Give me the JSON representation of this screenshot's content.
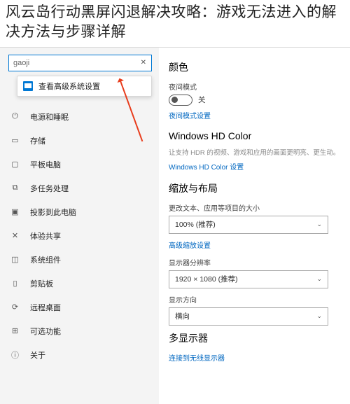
{
  "page_title": "风云岛行动黑屏闪退解决攻略：游戏无法进入的解决方法与步骤详解",
  "search": {
    "value": "gaoji",
    "dropdown_item": "查看高级系统设置"
  },
  "sidebar": {
    "items": [
      {
        "label": "电源和睡眠"
      },
      {
        "label": "存储"
      },
      {
        "label": "平板电脑"
      },
      {
        "label": "多任务处理"
      },
      {
        "label": "投影到此电脑"
      },
      {
        "label": "体验共享"
      },
      {
        "label": "系统组件"
      },
      {
        "label": "剪贴板"
      },
      {
        "label": "远程桌面"
      },
      {
        "label": "可选功能"
      },
      {
        "label": "关于"
      }
    ]
  },
  "content": {
    "color": {
      "heading": "颜色",
      "night_label": "夜间模式",
      "night_state": "关",
      "night_link": "夜间模式设置"
    },
    "hdcolor": {
      "heading": "Windows HD Color",
      "desc": "让支持 HDR 的视频、游戏和应用的画面更明亮、更生动。",
      "link": "Windows HD Color 设置"
    },
    "scale": {
      "heading": "缩放与布局",
      "size_label": "更改文本、应用等项目的大小",
      "size_value": "100% (推荐)",
      "scale_link": "高级缩放设置",
      "res_label": "显示器分辨率",
      "res_value": "1920 × 1080 (推荐)",
      "orient_label": "显示方向",
      "orient_value": "横向"
    },
    "multi": {
      "heading": "多显示器",
      "link": "连接到无线显示器"
    }
  }
}
